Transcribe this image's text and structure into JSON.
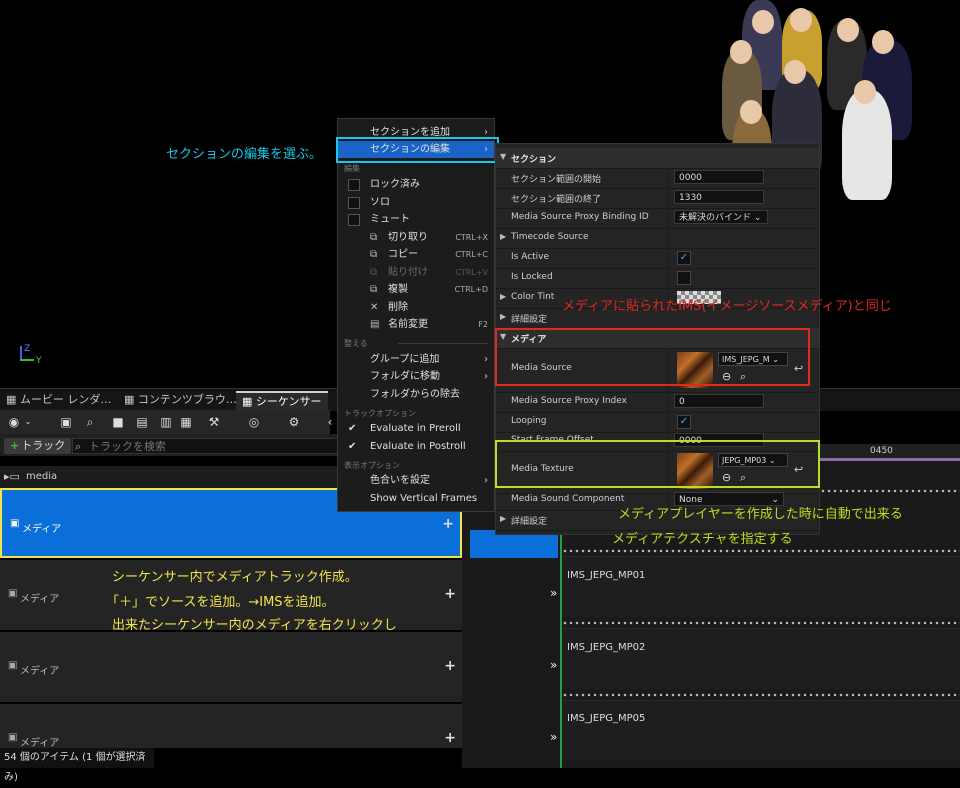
{
  "tabs": [
    {
      "label": "ムービー レンダ…"
    },
    {
      "label": "コンテンツブラウ…"
    },
    {
      "label": "シーケンサー"
    }
  ],
  "toolbar": {
    "track_button": "トラック",
    "search_placeholder": "トラックを検索"
  },
  "folder": {
    "name": "media"
  },
  "tracks": [
    {
      "label": "メディア"
    },
    {
      "label": "メディア"
    },
    {
      "label": "メディア"
    },
    {
      "label": "メディア"
    }
  ],
  "timeline": {
    "ruler_label": "0450",
    "clips": [
      "IMS_JEPG_MP01",
      "IMS_JEPG_MP02",
      "IMS_JEPG_MP05"
    ]
  },
  "status": {
    "items_text": "54 個のアイテム (1 個が選択済み)"
  },
  "menu": {
    "add_section": "セクションを追加",
    "edit_section": "セクションの編集",
    "edit_header": "編集",
    "locked": "ロック済み",
    "solo": "ソロ",
    "mute": "ミュート",
    "cut": "切り取り",
    "cut_sc": "CTRL+X",
    "copy": "コピー",
    "copy_sc": "CTRL+C",
    "paste": "貼り付け",
    "paste_sc": "CTRL+V",
    "duplicate": "複製",
    "duplicate_sc": "CTRL+D",
    "delete": "削除",
    "rename": "名前変更",
    "rename_sc": "F2",
    "organize_header": "整える",
    "add_to_group": "グループに追加",
    "move_to_folder": "フォルダに移動",
    "remove_from_folder": "フォルダからの除去",
    "track_options_header": "トラックオプション",
    "eval_preroll": "Evaluate in Preroll",
    "eval_postroll": "Evaluate in Postroll",
    "display_options_header": "表示オプション",
    "set_color": "色合いを設定",
    "show_vertical_frames": "Show Vertical Frames"
  },
  "details": {
    "section_header": "セクション",
    "range_start_label": "セクション範囲の開始",
    "range_start_value": "0000",
    "range_end_label": "セクション範囲の終了",
    "range_end_value": "1330",
    "proxy_binding_label": "Media Source Proxy Binding ID",
    "proxy_binding_value": "未解決のバインド",
    "timecode_label": "Timecode Source",
    "is_active_label": "Is Active",
    "is_locked_label": "Is Locked",
    "color_tint_label": "Color Tint",
    "advanced_label": "詳細設定",
    "media_header": "メディア",
    "media_source_label": "Media Source",
    "media_source_value": "IMS_JEPG_M",
    "proxy_index_label": "Media Source Proxy Index",
    "proxy_index_value": "0",
    "looping_label": "Looping",
    "start_frame_label": "Start Frame Offset",
    "start_frame_value": "0000",
    "media_texture_label": "Media Texture",
    "media_texture_value": "JEPG_MP03",
    "sound_component_label": "Media Sound Component",
    "sound_component_value": "None",
    "advanced2_label": "詳細設定"
  },
  "annotations": {
    "edit_section": "セクションの編集を選ぶ。",
    "same_ims": "メディアに貼られたIMS(イメージソースメディア)と同じ",
    "texture_line1": "メディアプレイヤーを作成した時に自動で出来る",
    "texture_line2": "メディアテクスチャを指定する",
    "sequencer_line1": "シーケンサー内でメディアトラック作成。",
    "sequencer_line2": "「＋」でソースを追加。→IMSを追加。",
    "sequencer_line3": "出来たシーケンサー内のメディアを右クリックし"
  },
  "axis": {
    "z": "Z",
    "y": "Y"
  },
  "colors": {
    "highlight": "#1a64c8",
    "cyan": "#19c8e6",
    "yellow": "#f0e64a",
    "red": "#e02a20",
    "lime": "#b8e020",
    "selected_row": "#0a6fd9"
  }
}
